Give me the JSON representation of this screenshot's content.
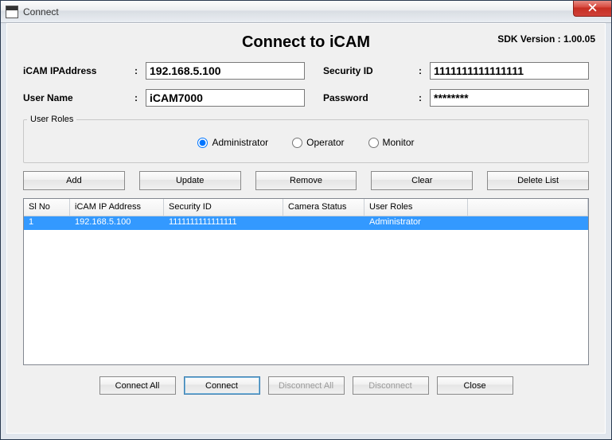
{
  "window": {
    "title": "Connect"
  },
  "header": {
    "main_title": "Connect to iCAM",
    "sdk_version_label": "SDK Version : 1.00.05"
  },
  "form": {
    "ip_label": "iCAM IPAddress",
    "ip_value": "192.168.5.100",
    "secid_label": "Security ID",
    "secid_value": "1111111111111111",
    "username_label": "User Name",
    "username_value": "iCAM7000",
    "password_label": "Password",
    "password_value": "********"
  },
  "roles": {
    "legend": "User Roles",
    "options": {
      "admin": "Administrator",
      "operator": "Operator",
      "monitor": "Monitor"
    },
    "selected": "admin"
  },
  "buttons": {
    "add": "Add",
    "update": "Update",
    "remove": "Remove",
    "clear": "Clear",
    "delete_list": "Delete List"
  },
  "table": {
    "headers": {
      "slno": "Sl No",
      "ip": "iCAM IP Address",
      "secid": "Security ID",
      "camera": "Camera Status",
      "roles": "User Roles"
    },
    "rows": [
      {
        "slno": "1",
        "ip": "192.168.5.100",
        "secid": "1111111111111111",
        "camera": "",
        "roles": "Administrator",
        "selected": true
      }
    ]
  },
  "bottom": {
    "connect_all": "Connect All",
    "connect": "Connect",
    "disconnect_all": "Disconnect All",
    "disconnect": "Disconnect",
    "close": "Close"
  }
}
